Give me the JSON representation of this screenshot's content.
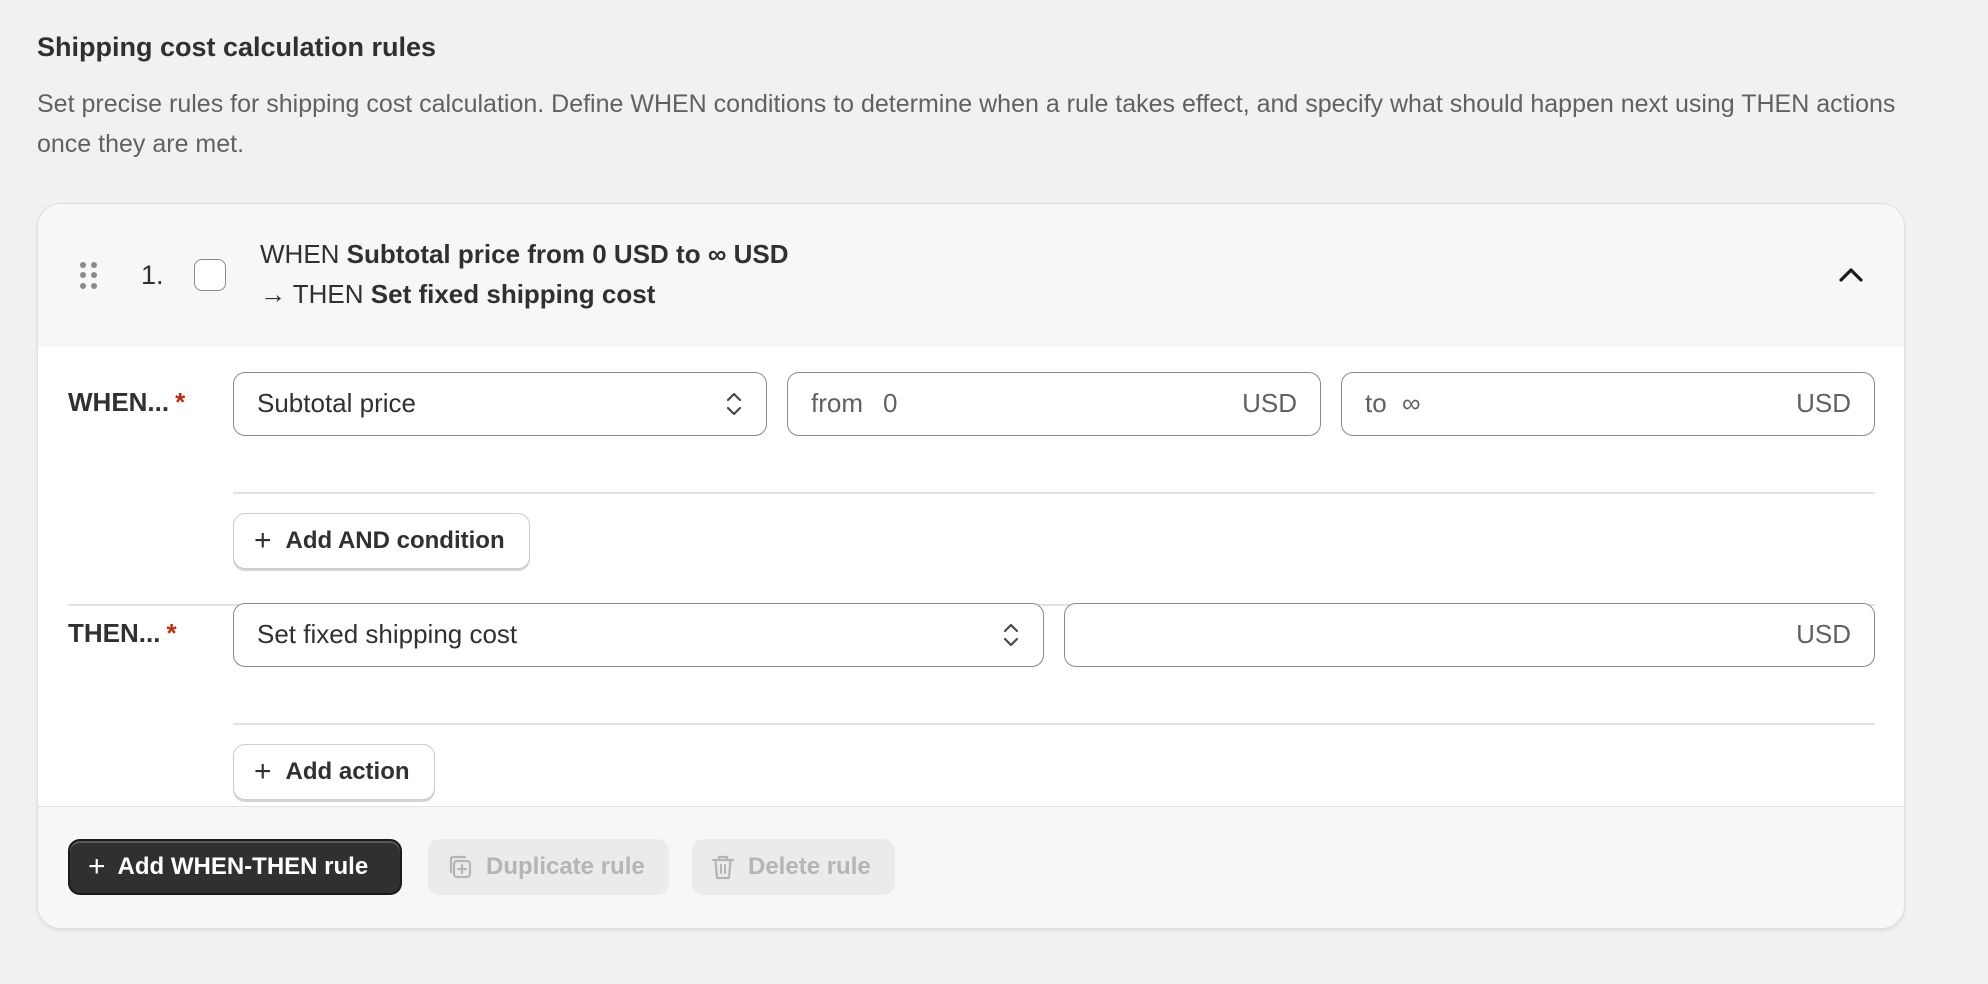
{
  "section": {
    "title": "Shipping cost calculation rules",
    "description": "Set precise rules for shipping cost calculation. Define WHEN conditions to determine when a rule takes effect, and specify what should happen next using THEN actions once they are met."
  },
  "rule": {
    "number": "1.",
    "summary_when_prefix": "WHEN ",
    "summary_when": "Subtotal price from 0 USD to ∞ USD",
    "summary_then_prefix": "→ THEN ",
    "summary_then": "Set fixed shipping cost",
    "when": {
      "label": "WHEN...",
      "required_mark": "*",
      "condition_select": "Subtotal price",
      "from_prefix": "from",
      "from_value": "0",
      "from_suffix": "USD",
      "to_prefix": "to",
      "to_value": "∞",
      "to_suffix": "USD",
      "add_condition_label": "Add AND condition"
    },
    "then": {
      "label": "THEN...",
      "required_mark": "*",
      "action_select": "Set fixed shipping cost",
      "amount_value": "",
      "amount_suffix": "USD",
      "add_action_label": "Add action"
    }
  },
  "footer": {
    "add_rule_label": "Add WHEN-THEN rule",
    "duplicate_label": "Duplicate rule",
    "delete_label": "Delete rule"
  }
}
